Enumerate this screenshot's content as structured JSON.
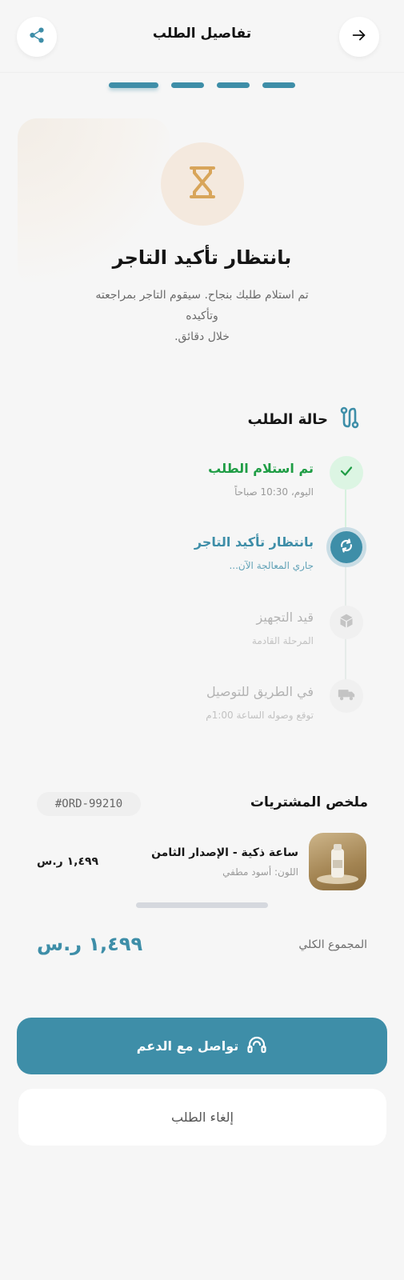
{
  "header": {
    "title": "تفاصيل الطلب",
    "back_icon": "arrow-right-icon",
    "share_icon": "share-icon"
  },
  "stepper": {
    "total_steps": 4,
    "current_step": 1
  },
  "hero": {
    "icon": "hourglass-icon",
    "title": "بانتظار تأكيد التاجر",
    "description_line1": "تم استلام طلبك بنجاح. سيقوم التاجر بمراجعته وتأكيده",
    "description_line2": "خلال دقائق."
  },
  "status": {
    "title": "حالة الطلب",
    "icon": "route-icon",
    "steps": [
      {
        "title": "تم استلام الطلب",
        "subtitle": "اليوم، 10:30 صباحاً",
        "state": "done",
        "icon": "check-icon"
      },
      {
        "title": "بانتظار تأكيد التاجر",
        "subtitle": "جاري المعالجة الآن...",
        "state": "current",
        "icon": "sync-icon"
      },
      {
        "title": "قيد التجهيز",
        "subtitle": "المرحلة القادمة",
        "state": "pending",
        "icon": "package-icon"
      },
      {
        "title": "في الطريق للتوصيل",
        "subtitle": "توقع وصوله الساعة 1:00م",
        "state": "pending",
        "icon": "truck-icon"
      }
    ]
  },
  "summary": {
    "title": "ملخص المشتريات",
    "order_id": "#ORD-99210",
    "item": {
      "name": "ساعة ذكية - الإصدار الثامن",
      "variant": "اللون: أسود مطفي",
      "price": "١,٤٩٩ ر.س"
    },
    "total_label": "المجموع الكلي",
    "total_value": "١,٤٩٩ ر.س"
  },
  "actions": {
    "support_label": "تواصل مع الدعم",
    "support_icon": "headset-icon",
    "cancel_label": "إلغاء الطلب"
  },
  "colors": {
    "accent": "#3e8ea8",
    "success": "#1f9d45",
    "success_bg": "#dcf5e3",
    "pending": "#b3b3b3",
    "hourglass": "#d8a55a"
  }
}
